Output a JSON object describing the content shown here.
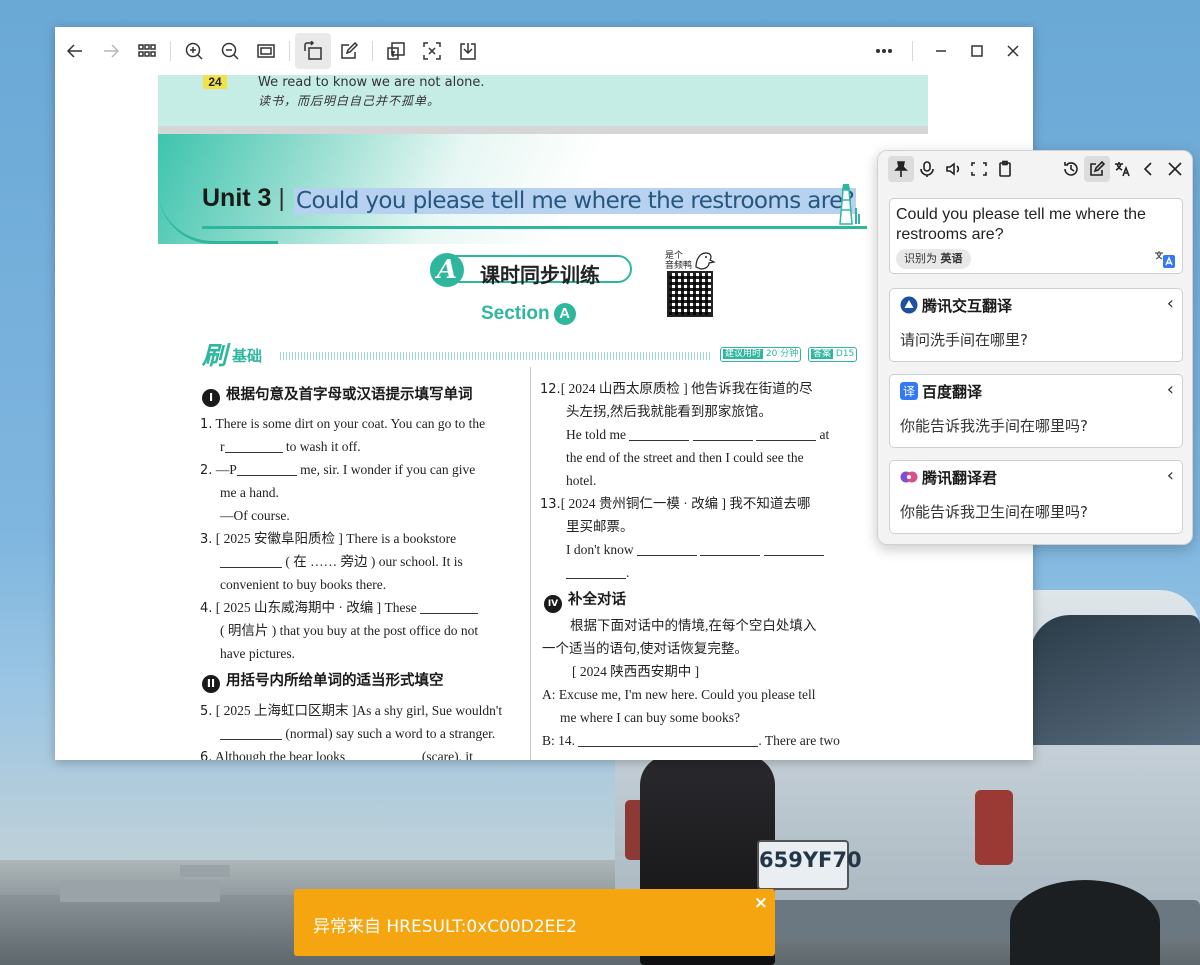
{
  "colors": {
    "accent_teal": "#2fb79e",
    "selection_bg": "#b6d2f0",
    "toast_bg": "#f4a50f",
    "popup_bg": "#f3f3f3"
  },
  "viewer": {
    "toolbar_icons": [
      "back-arrow-icon",
      "forward-arrow-icon",
      "grid-view-icon",
      "zoom-in-icon",
      "zoom-out-icon",
      "fit-page-icon",
      "rotate-icon",
      "edit-icon",
      "translate-doc-icon",
      "ocr-icon",
      "download-icon",
      "more-icon",
      "minimize-icon",
      "maximize-icon",
      "close-icon"
    ]
  },
  "document": {
    "prev_page_num": "24",
    "prev_quote_en": "We read to know we are not alone.",
    "prev_quote_zh": "读书，而后明白自己并不孤单。",
    "unit_label": "Unit 3",
    "unit_question": "Could you please tell me where the restrooms are?",
    "banner_letter": "A",
    "banner_title": "课时同步训练",
    "section_label": "Section",
    "section_letter": "A",
    "qr_caption": "是个\n音频鸭",
    "shua_big": "刷",
    "shua_small": "基础",
    "pill_time_label": "建议用时",
    "pill_time_value": "20 分钟",
    "pill_answer_label": "答案",
    "pill_answer_value": "D15",
    "heading_1": "根据句意及首字母或汉语提示填写单词",
    "heading_1_num": "I",
    "heading_2": "用括号内所给单词的适当形式填空",
    "heading_2_num": "II",
    "heading_4": "补全对话",
    "heading_4_num": "IV",
    "left_col": {
      "q1_num": "1.",
      "q1_a": "There is some dirt on your coat.  You can go to the",
      "q1_b_pre": "r",
      "q1_b_post": " to wash it off.",
      "q2_num": "2.",
      "q2_a_pre": "—P",
      "q2_a_post": " me, sir.  I wonder if you can give",
      "q2_b": "me a hand.",
      "q2_c": "—Of course.",
      "q3_num": "3.",
      "q3_a": "[ 2025 安徽阜阳质检 ] There  is  a  bookstore",
      "q3_b_post": " ( 在 …… 旁边 )  our  school.  It  is",
      "q3_c": "convenient to buy books there.",
      "q4_num": "4.",
      "q4_a": "[ 2025 山东威海期中 · 改编 ] These",
      "q4_b": "( 明信片 )  that  you  buy  at  the  post  office  do  not",
      "q4_c": "have pictures.",
      "q5_num": "5.",
      "q5_a": "[ 2025 上海虹口区期末 ]As a shy girl, Sue wouldn't",
      "q5_b_post": " (normal)  say such a word to a stranger.",
      "q6_num": "6.",
      "q6_a": "Although  the  bear  looks",
      "q6_b": "(scare),  it"
    },
    "right_col": {
      "q12_num": "12.",
      "q12_a": "[ 2024 山西太原质检 ] 他告诉我在街道的尽",
      "q12_b": "头左拐,然后我就能看到那家旅馆。",
      "q12_c_pre": "He  told  me",
      "q12_c_post": "at",
      "q12_d": "the  end  of  the  street  and  then  I  could  see  the",
      "q12_e": "hotel.",
      "q13_num": "13.",
      "q13_a": "[ 2024 贵州铜仁一模 · 改编 ] 我不知道去哪",
      "q13_b": "里买邮票。",
      "q13_c_pre": "I  don't  know",
      "q13_d_post": ".",
      "iv_intro_a": "根据下面对话中的情境,在每个空白处填入",
      "iv_intro_b": "一个适当的语句,使对话恢复完整。",
      "iv_source": "[ 2024 陕西西安期中 ]",
      "iv_a1": "A: Excuse  me,  I'm  new  here.  Could  you  please  tell",
      "iv_a2": "me where I can buy some books?",
      "iv_b1_pre": "B: 14.",
      "iv_b1_post": ". There are two"
    }
  },
  "translator": {
    "source_text": "Could you please tell me where the restrooms are?",
    "detected_prefix": "识别为",
    "detected_lang": "英语",
    "results": [
      {
        "engine": "腾讯交互翻译",
        "text": "请问洗手间在哪里?",
        "logo_color": "#1d4fa3"
      },
      {
        "engine": "百度翻译",
        "text": "你能告诉我洗手间在哪里吗?",
        "logo_color": "#3478f6"
      },
      {
        "engine": "腾讯翻译君",
        "text": "你能告诉我卫生间在哪里吗?",
        "logo_color": "#7b4fd6"
      }
    ]
  },
  "desktop": {
    "plate_text": "659YF70"
  },
  "toast": {
    "message": "异常来自 HRESULT:0xC00D2EE2",
    "close_symbol": "×"
  }
}
